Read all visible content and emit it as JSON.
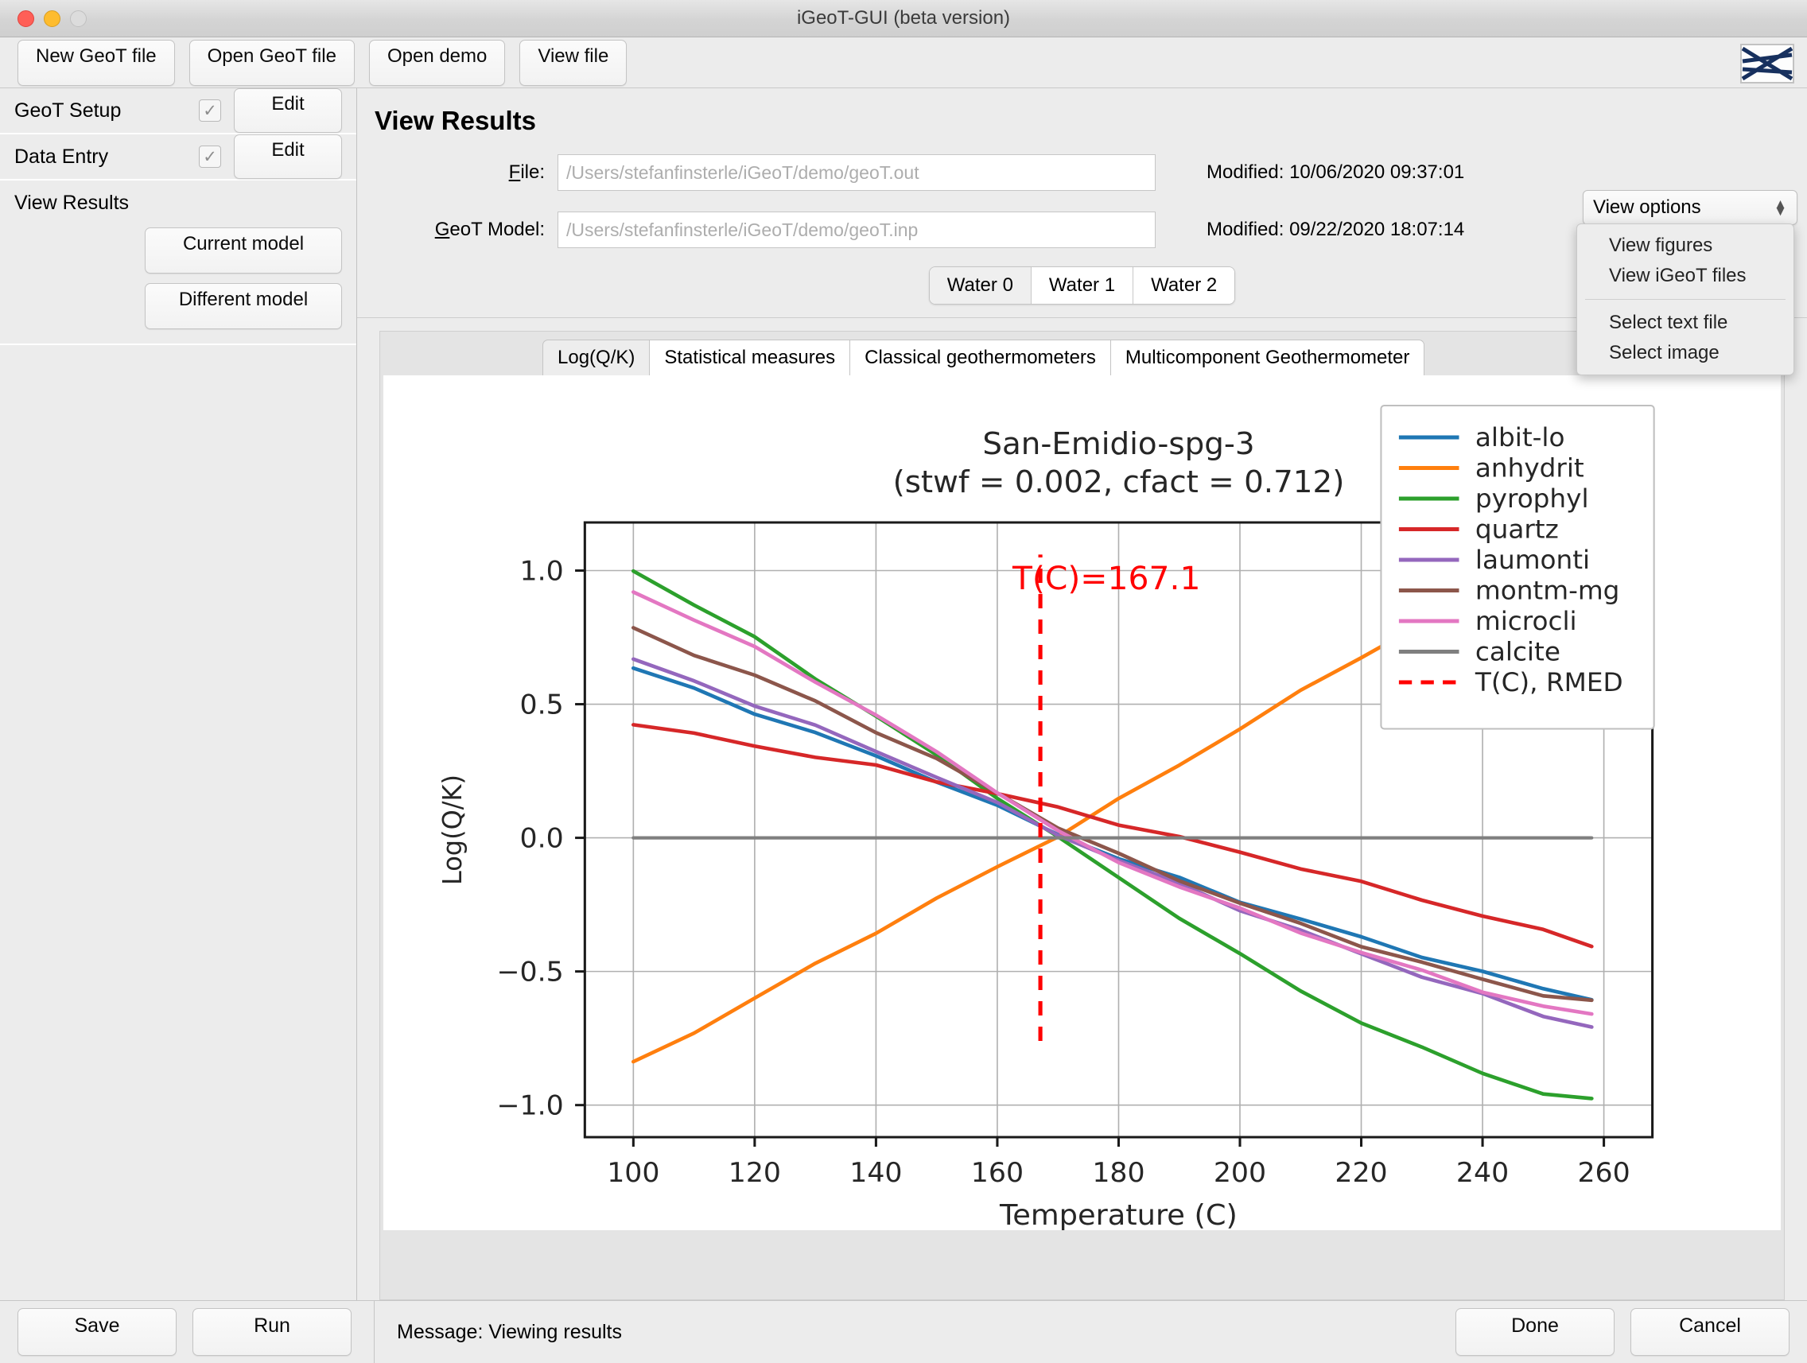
{
  "window": {
    "title": "iGeoT-GUI (beta version)",
    "traffic_lights": [
      "close",
      "minimize",
      "zoom"
    ]
  },
  "toolbar": {
    "buttons": [
      "New GeoT file",
      "Open GeoT file",
      "Open demo",
      "View file"
    ],
    "logo_alt": "igeot-logo"
  },
  "sidebar": {
    "rows": [
      {
        "label": "GeoT Setup",
        "checked": "✓",
        "action": "Edit"
      },
      {
        "label": "Data Entry",
        "checked": "✓",
        "action": "Edit"
      }
    ],
    "results": {
      "label": "View Results",
      "buttons": [
        "Current model",
        "Different model"
      ]
    }
  },
  "main": {
    "page_title": "View Results",
    "fields": [
      {
        "label_pre": "F",
        "label_key": "F",
        "label_rest": "ile:",
        "label": "File:",
        "value": "/Users/stefanfinsterle/iGeoT/demo/geoT.out",
        "modified_label": "Modified:",
        "modified_value": "10/06/2020 09:37:01"
      },
      {
        "label": "GeoT Model:",
        "value": "/Users/stefanfinsterle/iGeoT/demo/geoT.inp",
        "modified_label": "Modified:",
        "modified_value": "09/22/2020 18:07:14"
      }
    ],
    "view_options": {
      "selected": "View options",
      "group_1": [
        "View figures",
        "View iGeoT files"
      ],
      "group_2": [
        "Select text file",
        "Select image"
      ]
    },
    "water_tabs": {
      "items": [
        "Water 0",
        "Water 1",
        "Water 2"
      ],
      "active": "Water 0"
    },
    "sub_tabs": {
      "items": [
        "Log(Q/K)",
        "Statistical measures",
        "Classical geothermometers",
        "Multicomponent Geothermometer"
      ],
      "active": "Log(Q/K)"
    }
  },
  "footer": {
    "left_buttons": [
      "Save",
      "Run"
    ],
    "message_label": "Message:",
    "message_value": "Viewing results",
    "message_full": "Message:  Viewing results",
    "right_buttons": [
      "Done",
      "Cancel"
    ]
  },
  "chart_data": {
    "type": "line",
    "title": "San-Emidio-spg-3",
    "subtitle": "(stwf = 0.002, cfact = 0.712)",
    "xlabel": "Temperature (C)",
    "ylabel": "Log(Q/K)",
    "xlim": [
      92,
      268
    ],
    "ylim": [
      -1.12,
      1.18
    ],
    "xticks": [
      100,
      120,
      140,
      160,
      180,
      200,
      220,
      240,
      260
    ],
    "yticks": [
      -1.0,
      -0.5,
      0.0,
      0.5,
      1.0
    ],
    "ytick_labels": [
      "−1.0",
      "−0.5",
      "0.0",
      "0.5",
      "1.0"
    ],
    "grid": true,
    "legend_position": "upper right",
    "annotation": {
      "text": "T(C)=167.1",
      "x": 178,
      "y": 0.93,
      "color": "#ff0000"
    },
    "vline": {
      "label": "T(C), RMED",
      "x": 167.1,
      "y_from": -0.76,
      "y_to": 1.06,
      "color": "#ff0000",
      "style": "dashed"
    },
    "x": [
      100,
      110,
      120,
      130,
      140,
      150,
      160,
      170,
      180,
      190,
      200,
      210,
      220,
      230,
      240,
      250,
      258
    ],
    "series": [
      {
        "name": "albit-lo",
        "color": "#1f77b4",
        "values": [
          0.635,
          0.555,
          0.47,
          0.39,
          0.305,
          0.215,
          0.115,
          0.015,
          -0.075,
          -0.155,
          -0.235,
          -0.305,
          -0.375,
          -0.44,
          -0.505,
          -0.565,
          -0.6
        ]
      },
      {
        "name": "anhydrit",
        "color": "#ff7f0e",
        "values": [
          -0.845,
          -0.725,
          -0.6,
          -0.475,
          -0.35,
          -0.23,
          -0.11,
          0.01,
          0.14,
          0.275,
          0.41,
          0.545,
          0.68,
          0.8,
          0.915,
          1.03,
          1.095
        ]
      },
      {
        "name": "pyrophyl",
        "color": "#2ca02c",
        "values": [
          1.0,
          0.875,
          0.745,
          0.6,
          0.455,
          0.305,
          0.155,
          0.0,
          -0.15,
          -0.295,
          -0.44,
          -0.57,
          -0.69,
          -0.79,
          -0.875,
          -0.96,
          -0.98
        ]
      },
      {
        "name": "quartz",
        "color": "#d62728",
        "values": [
          0.43,
          0.385,
          0.345,
          0.305,
          0.265,
          0.215,
          0.165,
          0.11,
          0.055,
          0.0,
          -0.055,
          -0.11,
          -0.17,
          -0.23,
          -0.29,
          -0.35,
          -0.4
        ]
      },
      {
        "name": "laumonti",
        "color": "#9467bd",
        "values": [
          0.665,
          0.585,
          0.5,
          0.415,
          0.325,
          0.23,
          0.125,
          0.015,
          -0.085,
          -0.175,
          -0.265,
          -0.35,
          -0.435,
          -0.515,
          -0.59,
          -0.665,
          -0.705
        ]
      },
      {
        "name": "montm-mg",
        "color": "#8c564b",
        "values": [
          0.78,
          0.69,
          0.605,
          0.51,
          0.4,
          0.29,
          0.17,
          0.04,
          -0.065,
          -0.155,
          -0.245,
          -0.325,
          -0.4,
          -0.47,
          -0.53,
          -0.585,
          -0.615
        ]
      },
      {
        "name": "microcli",
        "color": "#e377c2",
        "values": [
          0.925,
          0.815,
          0.71,
          0.59,
          0.455,
          0.32,
          0.175,
          0.02,
          -0.09,
          -0.18,
          -0.27,
          -0.35,
          -0.43,
          -0.5,
          -0.57,
          -0.635,
          -0.66
        ]
      },
      {
        "name": "calcite",
        "color": "#7f7f7f",
        "values": [
          0.0,
          0.0,
          0.0,
          0.0,
          0.0,
          0.0,
          0.0,
          0.0,
          0.0,
          0.0,
          0.0,
          0.0,
          0.0,
          0.0,
          0.0,
          0.0,
          0.0
        ]
      }
    ],
    "legend_entries": [
      {
        "label": "albit-lo",
        "color": "#1f77b4",
        "style": "solid"
      },
      {
        "label": "anhydrit",
        "color": "#ff7f0e",
        "style": "solid"
      },
      {
        "label": "pyrophyl",
        "color": "#2ca02c",
        "style": "solid"
      },
      {
        "label": "quartz",
        "color": "#d62728",
        "style": "solid"
      },
      {
        "label": "laumonti",
        "color": "#9467bd",
        "style": "solid"
      },
      {
        "label": "montm-mg",
        "color": "#8c564b",
        "style": "solid"
      },
      {
        "label": "microcli",
        "color": "#e377c2",
        "style": "solid"
      },
      {
        "label": "calcite",
        "color": "#7f7f7f",
        "style": "solid"
      },
      {
        "label": "T(C), RMED",
        "color": "#ff0000",
        "style": "dashed"
      }
    ]
  }
}
